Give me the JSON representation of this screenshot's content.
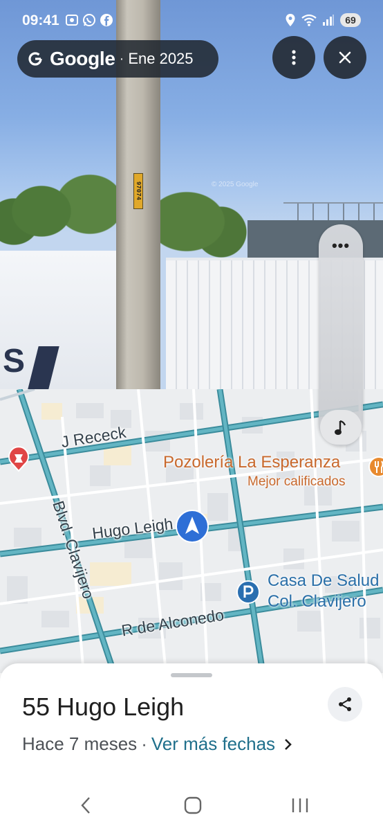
{
  "status_bar": {
    "time": "09:41",
    "battery": "69",
    "icons_left": [
      "screenshot-icon",
      "whatsapp-icon",
      "facebook-icon"
    ],
    "icons_right": [
      "location-icon",
      "wifi-icon",
      "signal-icon"
    ]
  },
  "street_view": {
    "provider": "Google",
    "separator": "·",
    "capture_date": "Ene 2025",
    "watermark": "© 2025 Google",
    "pole_tag": "97074"
  },
  "map": {
    "streets": [
      "J Receck",
      "Hugo Leigh",
      "Blvd. Clavijero",
      "R de Alconedo"
    ],
    "poi_restaurant": {
      "name": "Pozolería La Esperanza",
      "subtitle": "Mejor calificados"
    },
    "poi_parking": {
      "line1": "Casa De Salud",
      "line2": "Col. Clavijero"
    },
    "colors": {
      "road": "#4aa3b4",
      "road_edge": "#3b8c9c",
      "restaurant": "#c8682c",
      "poi_blue": "#2a6fa8",
      "pin_red": "#e04545"
    }
  },
  "sheet": {
    "address": "55 Hugo Leigh",
    "age": "Hace 7 meses",
    "separator": "·",
    "more_dates": "Ver más fechas"
  }
}
